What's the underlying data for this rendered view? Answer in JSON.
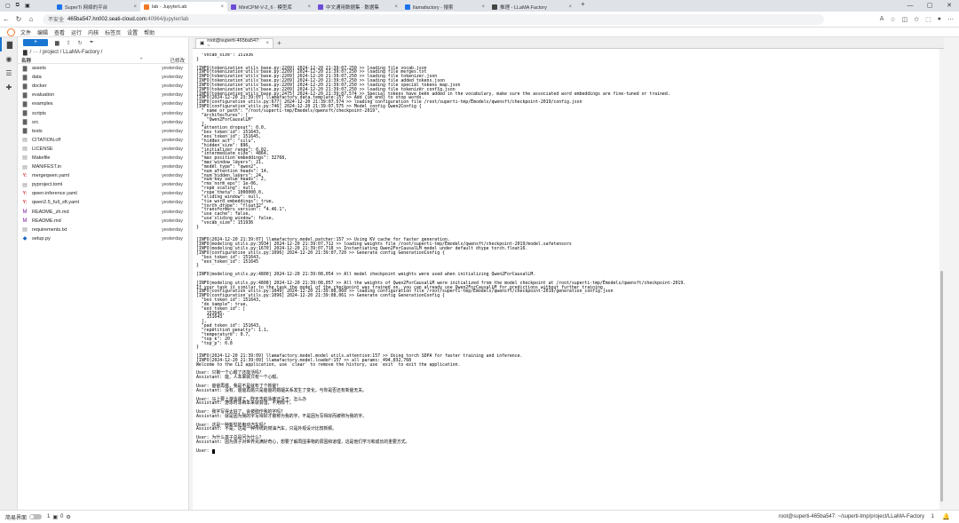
{
  "browser": {
    "tabs": [
      {
        "title": "SuperTi 网络的平台",
        "color": "#1a73e8",
        "active": false
      },
      {
        "title": "lab - JupyterLab",
        "color": "#f37726",
        "active": true
      },
      {
        "title": "MiniCPM-V-2_6 · 模型库",
        "color": "#6d4bd6",
        "active": false
      },
      {
        "title": "中文通用数据集 · 数据集",
        "color": "#6d4bd6",
        "active": false
      },
      {
        "title": "llamafactory - 搜索",
        "color": "#1a73e8",
        "active": false
      },
      {
        "title": "推理 - LLaMA Factory",
        "color": "#444444",
        "active": false
      }
    ],
    "warning": "不安全",
    "host": "465ba547.hn002.seati-cloud.com",
    "path": ":40964/jupyter/lab"
  },
  "menubar": [
    "文件",
    "编辑",
    "查看",
    "运行",
    "内核",
    "标签页",
    "设置",
    "帮助"
  ],
  "filebrowser": {
    "new_label": "+",
    "breadcrumb": "/ ··· / project / LLaMA-Factory /",
    "col_name": "名称",
    "col_modified": "已修改",
    "items": [
      {
        "name": "assets",
        "type": "folder",
        "modified": "yesterday"
      },
      {
        "name": "data",
        "type": "folder",
        "modified": "yesterday"
      },
      {
        "name": "docker",
        "type": "folder",
        "modified": "yesterday"
      },
      {
        "name": "evaluation",
        "type": "folder",
        "modified": "yesterday"
      },
      {
        "name": "examples",
        "type": "folder",
        "modified": "yesterday"
      },
      {
        "name": "scripts",
        "type": "folder",
        "modified": "yesterday"
      },
      {
        "name": "src",
        "type": "folder",
        "modified": "yesterday"
      },
      {
        "name": "tests",
        "type": "folder",
        "modified": "yesterday"
      },
      {
        "name": "CITATION.cff",
        "type": "file",
        "modified": "yesterday"
      },
      {
        "name": "LICENSE",
        "type": "file",
        "modified": "yesterday"
      },
      {
        "name": "Makefile",
        "type": "file",
        "modified": "yesterday"
      },
      {
        "name": "MANIFEST.in",
        "type": "file",
        "modified": "yesterday"
      },
      {
        "name": "mergeqwen.yaml",
        "type": "yaml",
        "modified": "yesterday"
      },
      {
        "name": "pyproject.toml",
        "type": "file",
        "modified": "yesterday"
      },
      {
        "name": "qwen-inference.yaml",
        "type": "yaml",
        "modified": "yesterday"
      },
      {
        "name": "qwen2.5_full_sft.yaml",
        "type": "yaml",
        "modified": "yesterday"
      },
      {
        "name": "README_zh.md",
        "type": "md",
        "modified": "yesterday"
      },
      {
        "name": "README.md",
        "type": "md",
        "modified": "yesterday"
      },
      {
        "name": "requirements.txt",
        "type": "file",
        "modified": "yesterday"
      },
      {
        "name": "setup.py",
        "type": "py",
        "modified": "yesterday"
      }
    ]
  },
  "terminal": {
    "tab_title": "root@superti-465ba547: ~",
    "lines": [
      "  \"vocab_size\": 151936",
      "}",
      "",
      "[INFO|tokenization_utils_base.py:2209] 2024-12-20 21:39:07,250 >> loading file vocab.json",
      "[INFO|tokenization_utils_base.py:2209] 2024-12-20 21:39:07,250 >> loading file merges.txt",
      "[INFO|tokenization_utils_base.py:2209] 2024-12-20 21:39:07,250 >> loading file tokenizer.json",
      "[INFO|tokenization_utils_base.py:2209] 2024-12-20 21:39:07,250 >> loading file added_tokens.json",
      "[INFO|tokenization_utils_base.py:2209] 2024-12-20 21:39:07,250 >> loading file special_tokens_map.json",
      "[INFO|tokenization_utils_base.py:2209] 2024-12-20 21:39:07,250 >> loading file tokenizer_config.json",
      "[INFO|tokenization_utils_base.py:2475] 2024-12-20 21:39:07,574 >> Special tokens have been added in the vocabulary, make sure the associated word embeddings are fine-tuned or trained.",
      "[INFO|2024-12-20 21:39:07] llamafactory.data.template:157 >> Add {im_end} to stop words.",
      "[INFO|configuration_utils.py:677] 2024-12-20 21:39:07,574 >> loading configuration file /root/superti-tmp/Ѐmodels/qwensft/checkpoint-2019/config.json",
      "[INFO|configuration_utils.py:746] 2024-12-20 21:39:07,575 >> Model config Qwen2Config {",
      "  \"_name_or_path\": \"/root/superti-tmp/Ѐmodels/qwensft/checkpoint-2019\",",
      "  \"architectures\": [",
      "    \"Qwen2ForCausalLM\"",
      "  ],",
      "  \"attention_dropout\": 0.0,",
      "  \"bos_token_id\": 151643,",
      "  \"eos_token_id\": 151645,",
      "  \"hidden_act\": \"silu\",",
      "  \"hidden_size\": 896,",
      "  \"initializer_range\": 0.02,",
      "  \"intermediate_size\": 4864,",
      "  \"max_position_embeddings\": 32768,",
      "  \"max_window_layers\": 21,",
      "  \"model_type\": \"qwen2\",",
      "  \"num_attention_heads\": 14,",
      "  \"num_hidden_layers\": 24,",
      "  \"num_key_value_heads\": 2,",
      "  \"rms_norm_eps\": 1e-06,",
      "  \"rope_scaling\": null,",
      "  \"rope_theta\": 1000000.0,",
      "  \"sliding_window\": null,",
      "  \"tie_word_embeddings\": true,",
      "  \"torch_dtype\": \"float32\",",
      "  \"transformers_version\": \"4.46.1\",",
      "  \"use_cache\": false,",
      "  \"use_sliding_window\": false,",
      "  \"vocab_size\": 151936",
      "}",
      "",
      "",
      "[INFO|2024-12-20 21:39:07] llamafactory.model.patcher:157 >> Using KV cache for faster generation.",
      "[INFO|modeling_utils.py:3934] 2024-12-20 21:39:07,712 >> loading weights file /root/superti-tmp/Ѐmodels/qwensft/checkpoint-2019/model.safetensors",
      "[INFO|modeling_utils.py:1670] 2024-12-20 21:39:07,718 >> Instantiating Qwen2ForCausalLM model under default dtype torch.float16.",
      "[INFO|configuration_utils.py:1096] 2024-12-20 21:39:07,720 >> Generate config GenerationConfig {",
      "  \"bos_token_id\": 151643,",
      "  \"eos_token_id\": 151645",
      "}",
      "",
      "[INFO|modeling_utils.py:4800] 2024-12-20 21:39:08,054 >> All model checkpoint weights were used when initializing Qwen2ForCausalLM.",
      "",
      "[INFO|modeling_utils.py:4808] 2024-12-20 21:39:08,057 >> All the weights of Qwen2ForCausalLM were initialized from the model checkpoint at /root/superti-tmp/Ѐmodels/qwensft/checkpoint-2019.",
      "If your task is similar to the task the model of the checkpoint was trained on, you can already use Qwen2ForCausalLM for predictions without further training.",
      "[INFO|configuration_utils.py:1049] 2024-12-20 21:39:08,060 >> loading configuration file /root/superti-tmp/Ѐmodels/qwensft/checkpoint-2019/generation_config.json",
      "[INFO|configuration_utils.py:1096] 2024-12-20 21:39:08,061 >> Generate config GenerationConfig {",
      "  \"bos_token_id\": 151643,",
      "  \"do_sample\": true,",
      "  \"eos_token_id\": [",
      "    151645,",
      "    151643",
      "  ],",
      "  \"pad_token_id\": 151643,",
      "  \"repetition_penalty\": 1.1,",
      "  \"temperature\": 0.7,",
      "  \"top_k\": 20,",
      "  \"top_p\": 0.8",
      "}",
      "",
      "[INFO|2024-12-20 21:39:09] llamafactory.model.model_utils.attention:157 >> Using torch SDPA for faster training and inference.",
      "[INFO|2024-12-20 21:39:09] llamafactory.model.loader:157 >> all params: 494,032,768",
      "Welcome to the CLI application, use `clear` to remove the history, use `exit` to exit the application.",
      "",
      "User: 只剩一个心眼了还能活吗？",
      "Assistant: 能，人本来就只有一个心眼。",
      "",
      "User: 爸爸再婚，我是不是就有了个新爸？",
      "Assistant: 没有，爸爸再婚只是爸爸的婚姻关系发生了变化，与你是否还有新爸无关。",
      "",
      "User: 马上要上游泳课了，昨天洗的泳裤还没干，怎么办",
      "Assistant: 游泳时泳裤本来就会湿，不用晾干。",
      "",
      "User: 我字写得太好了，会被称作我的字吗？",
      "Assistant: 就是因为我的字写得好才被称为我的字，不是因为写得好而被称为我的字。",
      "",
      "User: 这是一种新型的电动汽车吗？",
      "Assistant: 不是，这是一种传统的燃油汽车，只是外观设计比较新颖。",
      "",
      "User: 为什么孩子总是问为什么？",
      "Assistant: 因为孩子对世界充满好奇心，想要了解周围事物的原因和道理，这是他们学习和成长的重要方式。",
      "",
      "User: "
    ]
  },
  "statusbar": {
    "mode_label": "简易界面",
    "kernels": "1",
    "terminals": "0",
    "right_text": "root@superti-465ba547: ~/superti-tmp/project/LLaMA-Factory",
    "right_count": "1"
  }
}
